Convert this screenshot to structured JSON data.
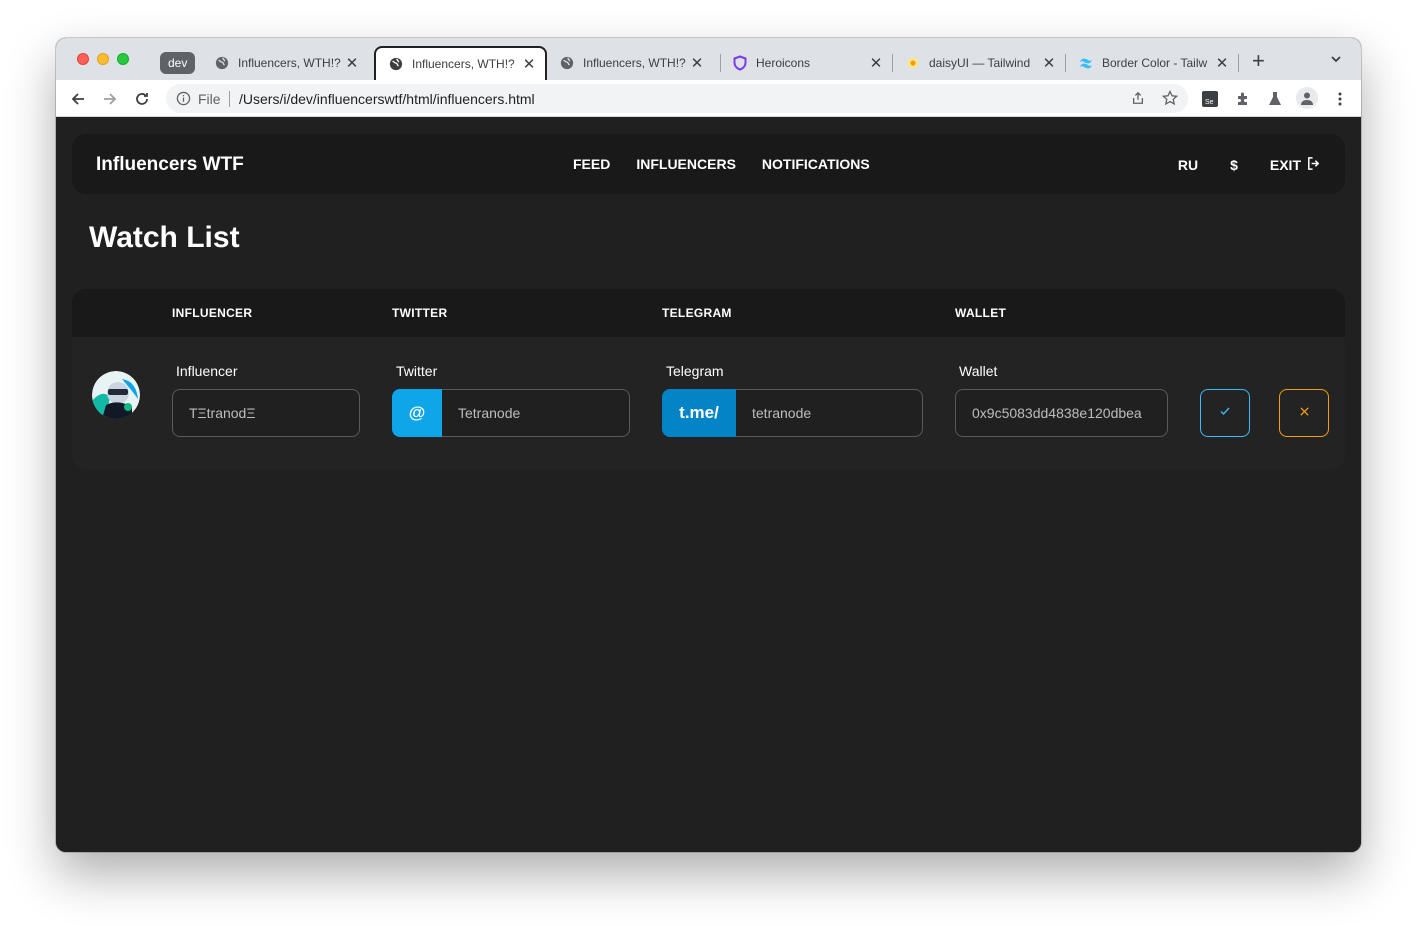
{
  "browser": {
    "group_label": "dev",
    "tabs": [
      {
        "title": "Influencers, WTH!?",
        "icon": "globe-icon"
      },
      {
        "title": "Influencers, WTH!?",
        "icon": "globe-icon",
        "active": true
      },
      {
        "title": "Influencers, WTH!?",
        "icon": "globe-icon"
      },
      {
        "title": "Heroicons",
        "icon": "heroicons-shield-icon"
      },
      {
        "title": "daisyUI — Tailwind",
        "icon": "daisyui-icon"
      },
      {
        "title": "Border Color - Tailw",
        "icon": "tailwind-icon"
      }
    ],
    "address": {
      "scheme": "File",
      "url": "/Users/i/dev/influencerswtf/html/influencers.html"
    }
  },
  "navbar": {
    "brand": "Influencers WTF",
    "menu": [
      "FEED",
      "INFLUENCERS",
      "NOTIFICATIONS"
    ],
    "lang": "RU",
    "currency": "$",
    "exit": "EXIT"
  },
  "page": {
    "title": "Watch List"
  },
  "table": {
    "headers": [
      "INFLUENCER",
      "TWITTER",
      "TELEGRAM",
      "WALLET"
    ],
    "row": {
      "influencer_label": "Influencer",
      "influencer_value": "TΞtranodΞ",
      "twitter_label": "Twitter",
      "twitter_prefix": "@",
      "twitter_value": "Tetranode",
      "telegram_label": "Telegram",
      "telegram_prefix": "t.me/",
      "telegram_value": "tetranode",
      "wallet_label": "Wallet",
      "wallet_value": "0x9c5083dd4838e120dbea"
    }
  },
  "colors": {
    "twitter_addon": "#1da1f2",
    "telegram_addon": "#0088cc",
    "confirm_border": "#38bdf8",
    "cancel_border": "#f59e0b"
  }
}
